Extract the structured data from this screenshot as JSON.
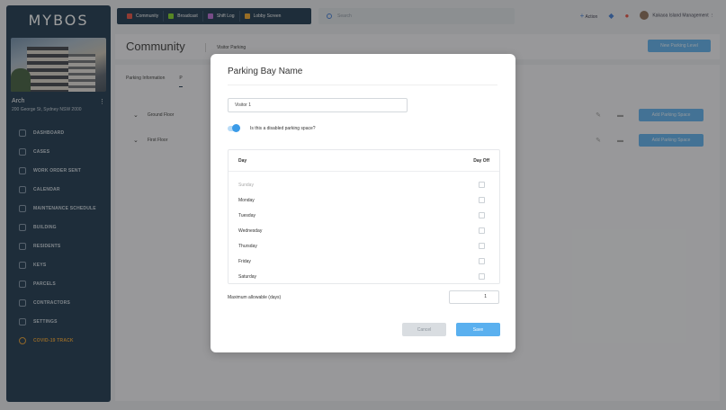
{
  "brand": "MYBOS",
  "site": {
    "name": "Arch",
    "address": "200 George St, Sydney NSW 2000"
  },
  "sidebar": {
    "items": [
      {
        "label": "DASHBOARD"
      },
      {
        "label": "CASES"
      },
      {
        "label": "WORK ORDER SENT"
      },
      {
        "label": "CALENDAR"
      },
      {
        "label": "MAINTENANCE SCHEDULE"
      },
      {
        "label": "BUILDING"
      },
      {
        "label": "RESIDENTS"
      },
      {
        "label": "KEYS"
      },
      {
        "label": "PARCELS"
      },
      {
        "label": "CONTRACTORS"
      },
      {
        "label": "SETTINGS"
      },
      {
        "label": "COVID-19 TRACK"
      }
    ]
  },
  "topnav": {
    "items": [
      {
        "label": "Community",
        "color": "#e74c3c"
      },
      {
        "label": "Broadcast",
        "color": "#7ed321"
      },
      {
        "label": "Shift Log",
        "color": "#b86bd6"
      },
      {
        "label": "Lobby Screen",
        "color": "#f5a623"
      }
    ],
    "search_placeholder": "Search",
    "action_label": "Action",
    "user_label": "Kakaoa Island Management"
  },
  "page": {
    "title": "Community",
    "subtitle": "Visitor Parking",
    "new_level_button": "New Parking Level",
    "tabs": [
      "Parking Information",
      "P"
    ],
    "floors": [
      {
        "label": "Ground Floor",
        "add_label": "Add Parking Space"
      },
      {
        "label": "First Floor",
        "add_label": "Add Parking Space"
      }
    ]
  },
  "modal": {
    "title": "Parking Bay Name",
    "name_value": "Visitor 1",
    "disabled_toggle_label": "Is this a disabled parking space?",
    "disabled_toggle_on": true,
    "table": {
      "col_day": "Day",
      "col_dayoff": "Day Off",
      "rows": [
        {
          "day": "Sunday"
        },
        {
          "day": "Monday"
        },
        {
          "day": "Tuesday"
        },
        {
          "day": "Wednesday"
        },
        {
          "day": "Thursday"
        },
        {
          "day": "Friday"
        },
        {
          "day": "Saturday"
        }
      ]
    },
    "max_label": "Maximum allowable (days)",
    "max_value": "1",
    "cancel_label": "Cancel",
    "save_label": "Save"
  },
  "colors": {
    "sidebar_bg": "#16324a",
    "accent_blue": "#5ab0ef",
    "active_nav": "#e39a2a"
  }
}
